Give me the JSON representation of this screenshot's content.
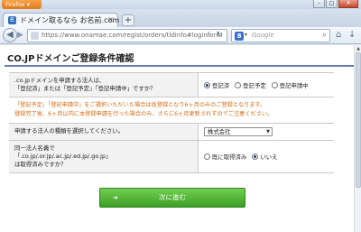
{
  "browser": {
    "app_button": "Firefox",
    "tab_title": "ドメイン取るなら お名前.com",
    "url": "https://www.onamae.com/regist/orders/tldinfo#loginform",
    "search_placeholder": "Google",
    "search_engine_letter": "8"
  },
  "page": {
    "title": "CO.JPドメインご登録条件確認",
    "q1": {
      "label_line1": ".co.jpドメインを申請する法人は、",
      "label_line2": "「登記済」または「登記予定」「登記申請中」ですか？",
      "options": [
        "登記済",
        "登記予定",
        "登記申請中"
      ],
      "selected": "登記済"
    },
    "notice_line1": "「登記予定」「登記申請中」をご選択いただいた場合は仮登録となり6ヶ月のみのご登録となります。",
    "notice_line2": "登録完了後、6ヶ月以内に本登録申請を行った場合のみ、さらに6ヶ月更新されずのでご注意ください。",
    "q2": {
      "label": "申請する法人の種類を選択してください。",
      "selected": "株式会社"
    },
    "q3": {
      "label_line1": "同一法人名義で",
      "label_line2": "「.co.jp/.or.jp/.ac.jp/.ed.jp/.go.jp」",
      "label_line3": "は取得済みですか？",
      "options": [
        "既に取得済み",
        "いいえ"
      ],
      "selected": "いいえ"
    },
    "next_button": "次に進む"
  }
}
